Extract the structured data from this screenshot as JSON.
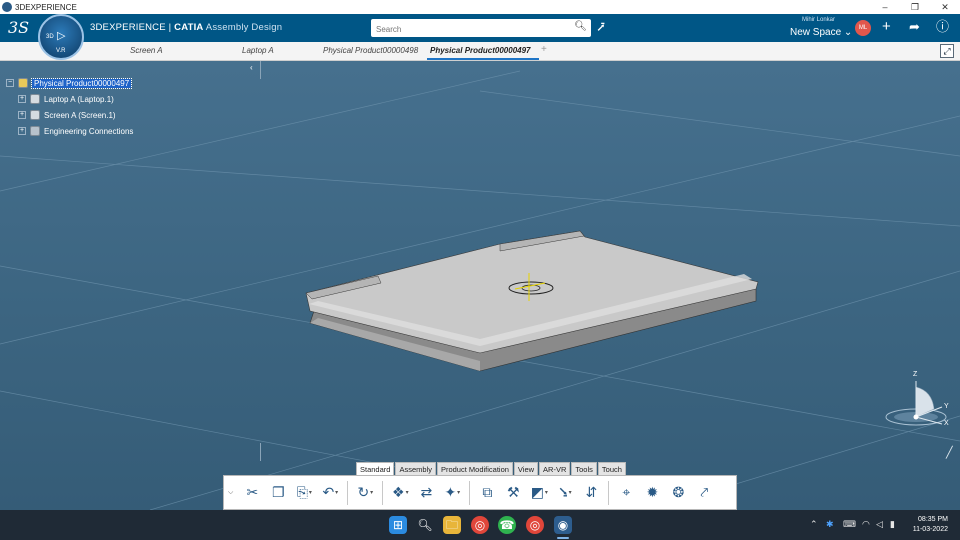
{
  "window": {
    "title": "3DEXPERIENCE",
    "controls": [
      "–",
      "❐",
      "✕"
    ]
  },
  "header": {
    "logo": "3S",
    "compass": {
      "label_3d": "3D",
      "version": "V.R"
    },
    "brand_prefix": "3DEXPERIENCE",
    "brand_separator": " | ",
    "brand_product": "CATIA",
    "brand_app": " Assembly Design",
    "search_placeholder": "Search",
    "user_name": "Mihir Lonkar",
    "space_label": "New Space",
    "avatar_initials": "ML"
  },
  "tabs": [
    {
      "label": "Screen A",
      "active": false
    },
    {
      "label": "Laptop A",
      "active": false
    },
    {
      "label": "Physical Product00000498",
      "active": false
    },
    {
      "label": "Physical Product00000497",
      "active": true
    }
  ],
  "tree": [
    {
      "label": "Physical Product00000497",
      "selected": true,
      "level": 0,
      "icon": "product-icon"
    },
    {
      "label": "Laptop A (Laptop.1)",
      "selected": false,
      "level": 1,
      "icon": "part-icon"
    },
    {
      "label": "Screen A (Screen.1)",
      "selected": false,
      "level": 1,
      "icon": "part-icon"
    },
    {
      "label": "Engineering Connections",
      "selected": false,
      "level": 1,
      "icon": "connections-icon"
    }
  ],
  "axes": {
    "x": "X",
    "y": "Y",
    "z": "Z"
  },
  "toolbar_tabs": [
    {
      "label": "Standard",
      "active": true
    },
    {
      "label": "Assembly",
      "active": false
    },
    {
      "label": "Product Modification",
      "active": false
    },
    {
      "label": "View",
      "active": false
    },
    {
      "label": "AR-VR",
      "active": false
    },
    {
      "label": "Tools",
      "active": false
    },
    {
      "label": "Touch",
      "active": false
    }
  ],
  "toolbar_tools": [
    "cut-icon",
    "copy-icon",
    "paste-icon",
    "undo-icon",
    "update-icon",
    "insert-product-icon",
    "replace-icon",
    "exploded-view-icon",
    "engineering-connection-icon",
    "fix-icon",
    "section-icon",
    "compass-axis-icon",
    "manipulate-icon",
    "measure-icon",
    "clash-icon",
    "interference-icon",
    "publish-icon"
  ],
  "taskbar": {
    "time": "08:35 PM",
    "date": "11-03-2022"
  }
}
